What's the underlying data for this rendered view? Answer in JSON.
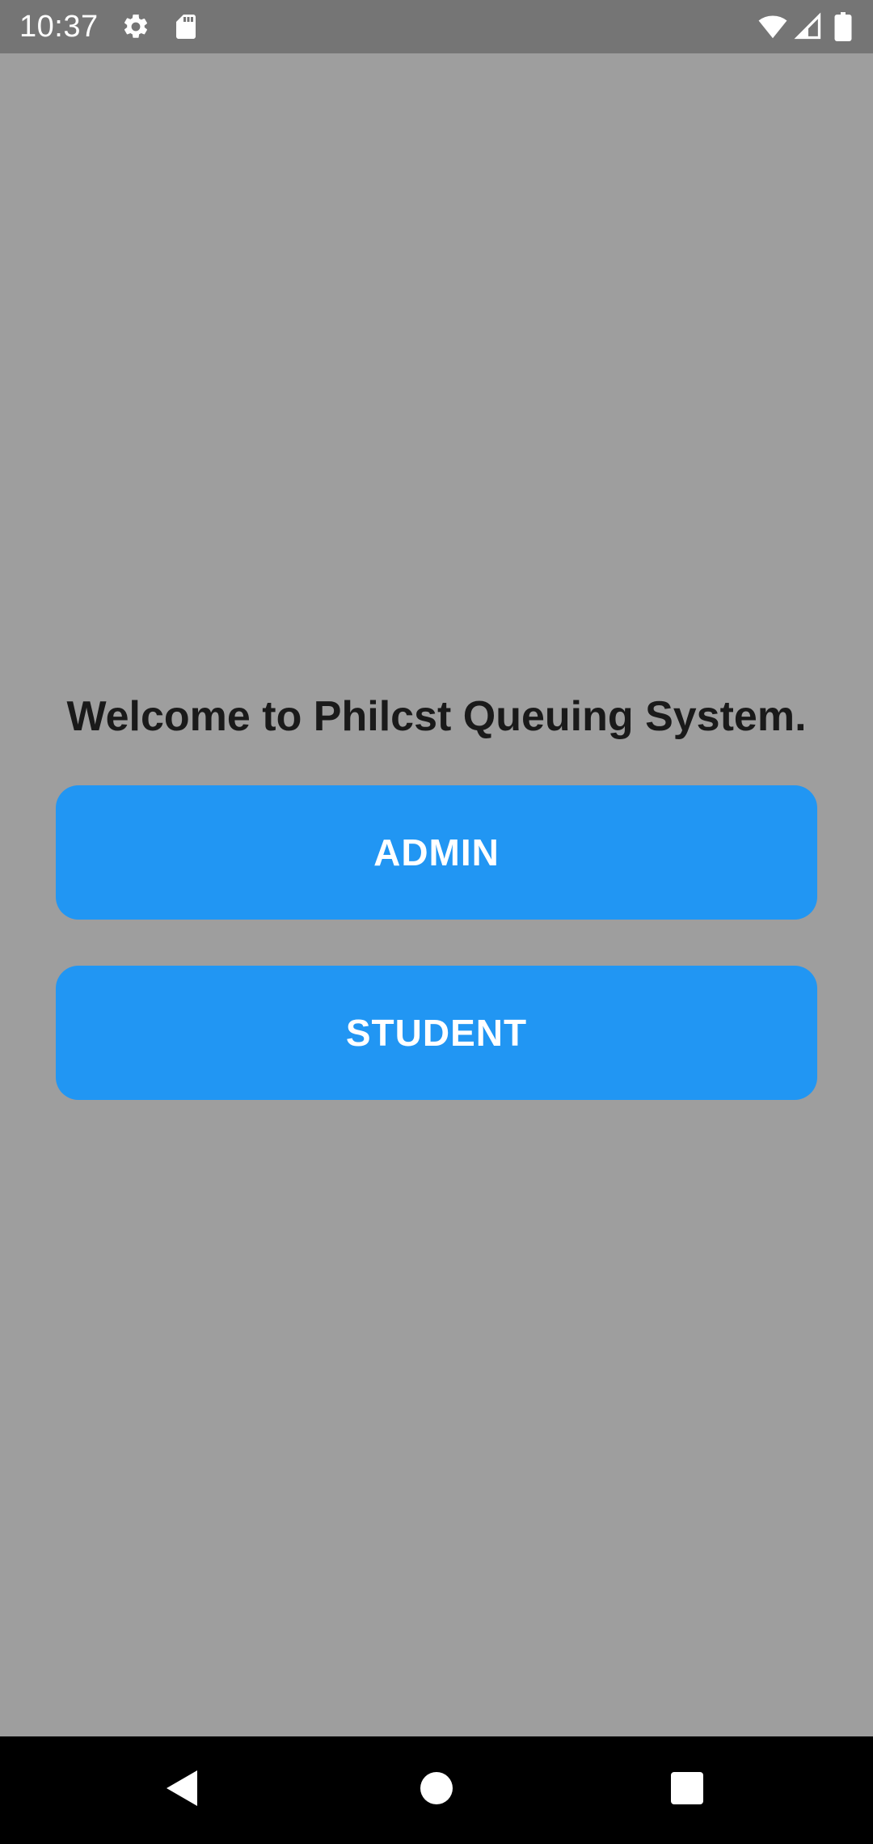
{
  "status_bar": {
    "time": "10:37",
    "icons": [
      "settings-icon",
      "sd-card-icon",
      "wifi-icon",
      "signal-icon",
      "battery-icon"
    ],
    "background": "#757575"
  },
  "main": {
    "welcome_text": "Welcome to Philcst Queuing System.",
    "buttons": {
      "admin_label": "ADMIN",
      "student_label": "STUDENT"
    },
    "accent_color": "#2196f3",
    "background": "#9e9e9e"
  },
  "nav_bar": {
    "icons": [
      "back-icon",
      "home-icon",
      "recents-icon"
    ],
    "background": "#000000"
  }
}
